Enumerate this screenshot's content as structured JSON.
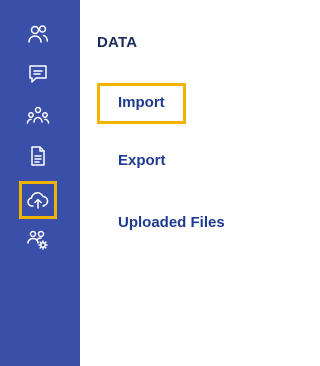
{
  "sidebar": {
    "items": [
      {
        "icon": "users-icon",
        "active": false
      },
      {
        "icon": "message-icon",
        "active": false
      },
      {
        "icon": "team-icon",
        "active": false
      },
      {
        "icon": "document-icon",
        "active": false
      },
      {
        "icon": "cloud-upload-icon",
        "active": true
      },
      {
        "icon": "user-settings-icon",
        "active": false
      }
    ],
    "background": "#3a4fa8",
    "highlight_color": "#f0b400"
  },
  "panel": {
    "title": "DATA",
    "items": [
      {
        "label": "Import",
        "highlighted": true
      },
      {
        "label": "Export",
        "highlighted": false
      },
      {
        "label": "Uploaded Files",
        "highlighted": false
      }
    ]
  }
}
